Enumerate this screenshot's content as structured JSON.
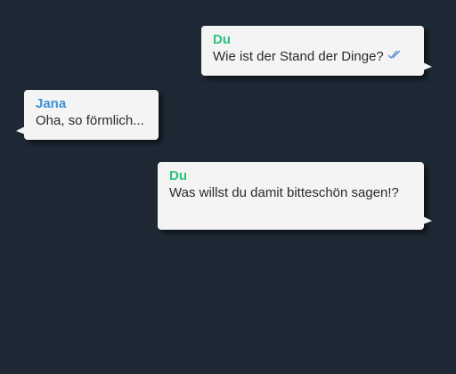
{
  "messages": [
    {
      "sender": "Du",
      "text": "Wie ist der Stand der Dinge?",
      "status_icon": "double-check-icon"
    },
    {
      "sender": "Jana",
      "text": "Oha, so förmlich..."
    },
    {
      "sender": "Du",
      "text": "Was willst du damit bitteschön sagen!?"
    }
  ],
  "colors": {
    "background": "#1e2935",
    "bubble": "#f4f4f4",
    "self_name": "#2ec27e",
    "other_name": "#3d8fd6",
    "read_check": "#5b8fd6"
  }
}
